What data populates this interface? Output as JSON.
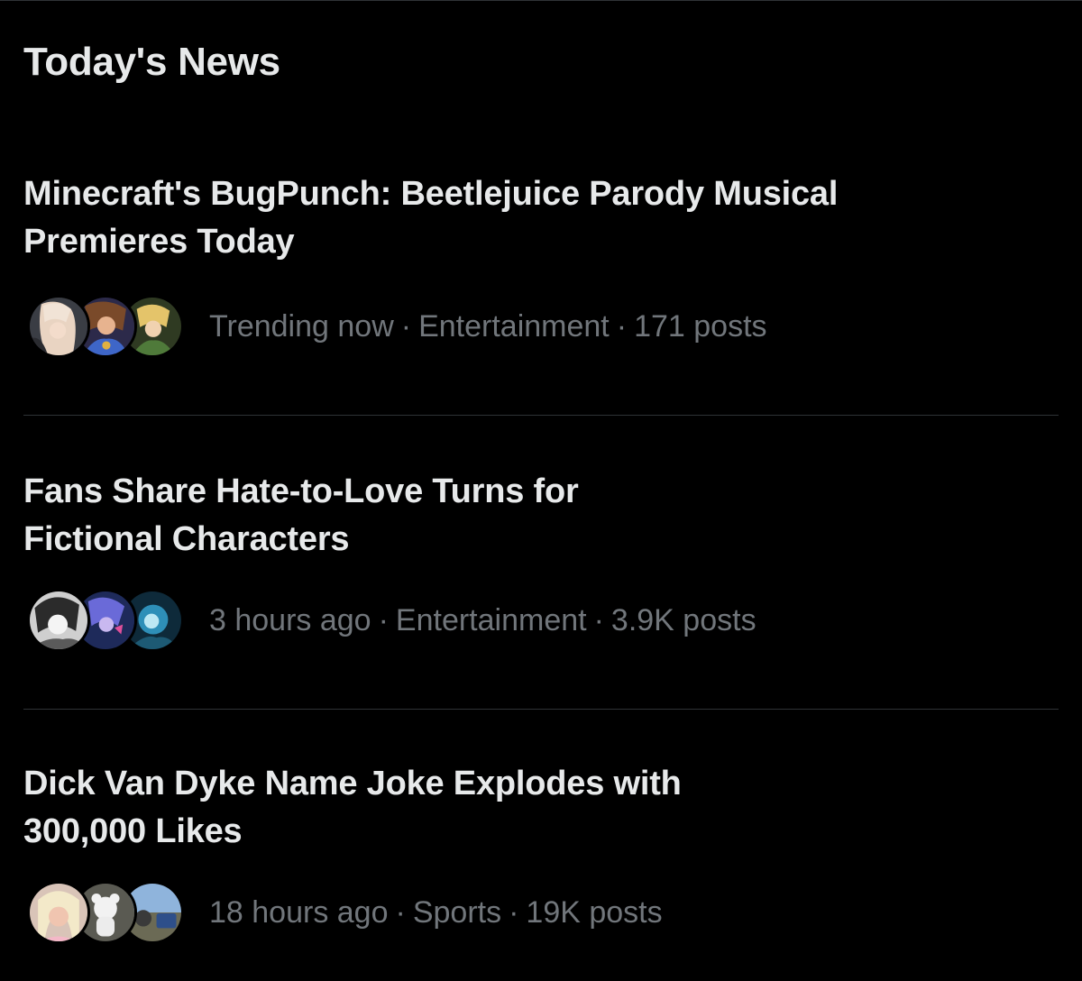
{
  "section": {
    "title": "Today's News"
  },
  "news": [
    {
      "headline_line1": "Minecraft's BugPunch: Beetlejuice Parody Musical",
      "headline_line2": "Premieres Today",
      "time": "Trending now",
      "category": "Entertainment",
      "posts": "171 posts",
      "separator": "·"
    },
    {
      "headline_line1": "Fans Share Hate-to-Love Turns for",
      "headline_line2": "Fictional Characters",
      "time": "3 hours ago",
      "category": "Entertainment",
      "posts": "3.9K posts",
      "separator": "·"
    },
    {
      "headline_line1": "Dick Van Dyke Name Joke Explodes with",
      "headline_line2": "300,000 Likes",
      "time": "18 hours ago",
      "category": "Sports",
      "posts": "19K posts",
      "separator": "·"
    }
  ],
  "colors": {
    "background": "#000000",
    "headline": "#e7e9ea",
    "meta": "#71767b",
    "divider": "#2f3336"
  }
}
